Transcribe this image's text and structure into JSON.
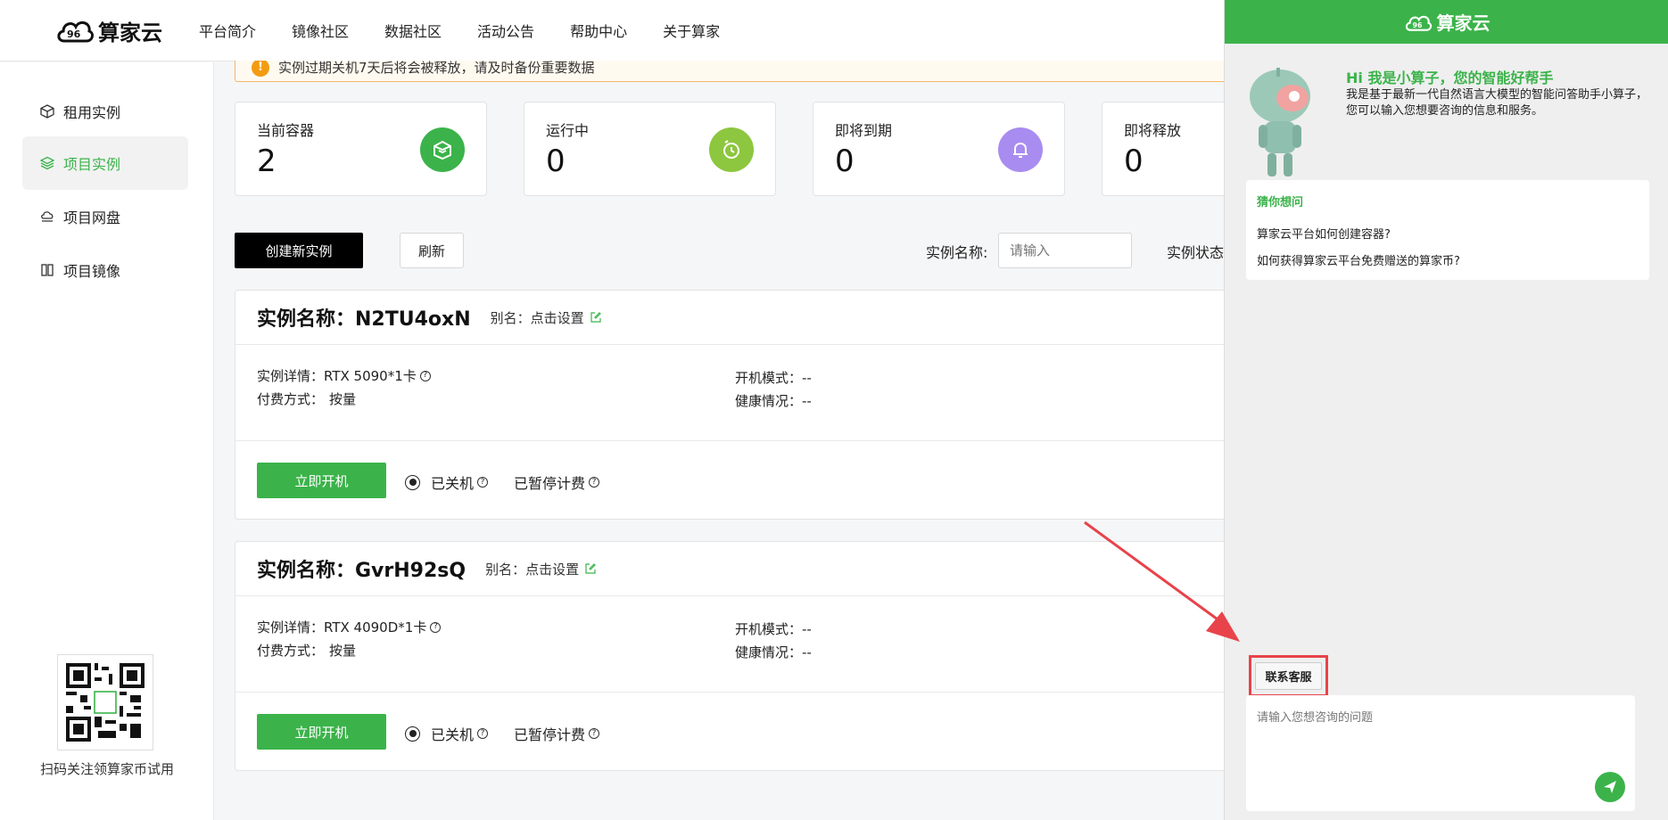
{
  "header": {
    "logo_text": "算家云",
    "nav": [
      "平台简介",
      "镜像社区",
      "数据社区",
      "活动公告",
      "帮助中心",
      "关于算家"
    ]
  },
  "sidebar": {
    "items": [
      {
        "label": "租用实例",
        "icon": "box-icon"
      },
      {
        "label": "项目实例",
        "icon": "layers-icon"
      },
      {
        "label": "项目网盘",
        "icon": "cloud-drive-icon"
      },
      {
        "label": "项目镜像",
        "icon": "image-columns-icon"
      }
    ],
    "active_index": 1,
    "qr_caption": "扫码关注领算家币试用"
  },
  "main": {
    "warning": "实例过期关机7天后将会被释放，请及时备份重要数据",
    "stats": [
      {
        "label": "当前容器",
        "value": "2",
        "color": "#3bb34a"
      },
      {
        "label": "运行中",
        "value": "0",
        "color": "#8dc63f"
      },
      {
        "label": "即将到期",
        "value": "0",
        "color": "#a98cf0"
      },
      {
        "label": "即将释放",
        "value": "0",
        "color": "#e74c3c"
      }
    ],
    "create_button": "创建新实例",
    "refresh_button": "刷新",
    "filter_name_label": "实例名称:",
    "filter_name_placeholder": "请输入",
    "filter_status_label": "实例状态",
    "instances": [
      {
        "title": "实例名称：N2TU4oxN",
        "alias": "别名：点击设置",
        "detail_label": "实例详情：",
        "detail_value": "RTX 5090*1卡",
        "pay_label": "付费方式：",
        "pay_value": "按量",
        "boot_label": "开机模式：",
        "boot_value": "--",
        "health_label": "健康情况：",
        "health_value": "--",
        "start_button": "立即开机",
        "status_off": "已关机",
        "status_billing": "已暂停计费"
      },
      {
        "title": "实例名称：GvrH92sQ",
        "alias": "别名：点击设置",
        "detail_label": "实例详情：",
        "detail_value": "RTX 4090D*1卡",
        "pay_label": "付费方式：",
        "pay_value": "按量",
        "boot_label": "开机模式：",
        "boot_value": "--",
        "health_label": "健康情况：",
        "health_value": "--",
        "start_button": "立即开机",
        "status_off": "已关机",
        "status_billing": "已暂停计费"
      }
    ]
  },
  "chat": {
    "title": "算家云",
    "greeting_title": "Hi 我是小算子，您的智能好帮手",
    "greeting_text": "我是基于最新一代自然语言大模型的智能问答助手小算子，您可以输入您想要咨询的信息和服务。",
    "guess_title": "猜你想问",
    "questions": [
      "算家云平台如何创建容器?",
      "如何获得算家云平台免费赠送的算家币?"
    ],
    "contact_button": "联系客服",
    "input_placeholder": "请输入您想咨询的问题",
    "accent_color": "#3bb34a",
    "highlight_color": "#e8434a"
  }
}
